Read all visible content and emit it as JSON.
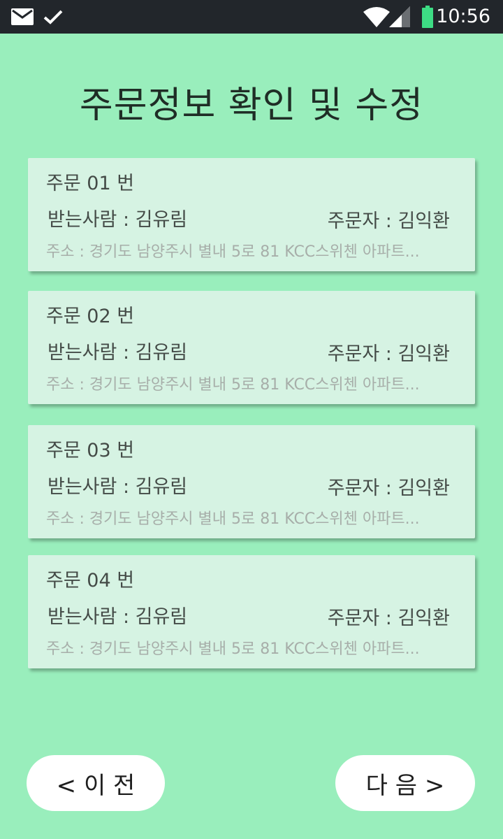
{
  "status_bar": {
    "icons": [
      "mail-icon",
      "check-icon",
      "wifi-icon",
      "signal-icon",
      "battery-icon"
    ],
    "time": "10:56",
    "battery_color": "#3ddc84"
  },
  "page": {
    "title": "주문정보 확인 및 수정",
    "background": "#99eebc"
  },
  "orders": [
    {
      "order": "주문 01 번",
      "recipient": "받는사람 :  김유림",
      "orderer": "주문자 : 김익환",
      "address": "주소 : 경기도 남양주시 별내 5로 81 KCC스위첸 아파트..."
    },
    {
      "order": "주문 02 번",
      "recipient": "받는사람 :  김유림",
      "orderer": "주문자 : 김익환",
      "address": "주소 : 경기도 남양주시 별내 5로 81 KCC스위첸 아파트..."
    },
    {
      "order": "주문 03 번",
      "recipient": "받는사람 :  김유림",
      "orderer": "주문자 : 김익환",
      "address": "주소 : 경기도 남양주시 별내 5로 81 KCC스위첸 아파트..."
    },
    {
      "order": "주문 04 번",
      "recipient": "받는사람 :  김유림",
      "orderer": "주문자 : 김익환",
      "address": "주소 : 경기도 남양주시 별내 5로 81 KCC스위첸 아파트..."
    }
  ],
  "nav": {
    "prev_label": "< 이 전",
    "next_label": "다 음 >"
  }
}
